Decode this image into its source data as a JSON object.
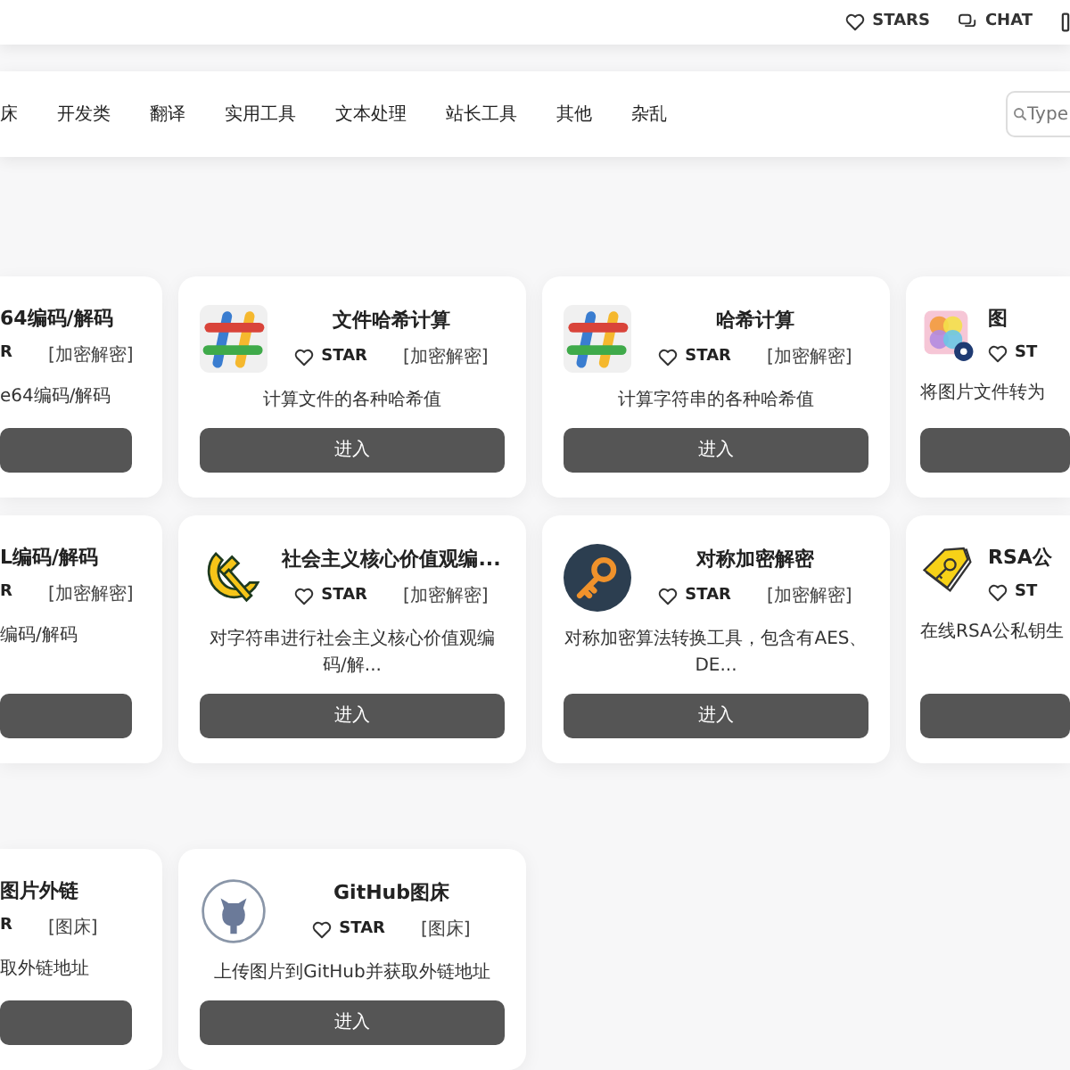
{
  "top_bar": {
    "links": [
      {
        "kind": "heart",
        "label": "STARS"
      },
      {
        "kind": "chat",
        "label": "CHAT"
      },
      {
        "kind": "square"
      }
    ]
  },
  "nav": {
    "items": [
      "床",
      "开发类",
      "翻译",
      "实用工具",
      "文本处理",
      "站长工具",
      "其他",
      "杂乱"
    ],
    "search": {
      "placeholder": "Type"
    }
  },
  "sections": [
    {
      "rows": [
        {
          "cards": [
            {
              "kind": "left-partial",
              "title": "64编码/解码",
              "star": "R",
              "tag": "[加密解密]",
              "desc": "e64编码/解码"
            },
            {
              "kind": "full",
              "icon": {
                "kind": "hash"
              },
              "title": "文件哈希计算",
              "star": "STAR",
              "tag": "[加密解密]",
              "desc": "计算文件的各种哈希值",
              "button": "进入"
            },
            {
              "kind": "full",
              "icon": {
                "kind": "hash"
              },
              "title": "哈希计算",
              "star": "STAR",
              "tag": "[加密解密]",
              "desc": "计算字符串的各种哈希值",
              "button": "进入"
            },
            {
              "kind": "right-partial",
              "icon": {
                "kind": "photos"
              },
              "title": "图",
              "star": "ST",
              "desc": "将图片文件转为"
            }
          ]
        },
        {
          "cards": [
            {
              "kind": "left-partial",
              "title": "L编码/解码",
              "star": "R",
              "tag": "[加密解密]",
              "desc": "编码/解码"
            },
            {
              "kind": "full",
              "icon": {
                "kind": "hammer-sickle"
              },
              "title": "社会主义核心价值观编...",
              "star": "STAR",
              "tag": "[加密解密]",
              "desc": "对字符串进行社会主义核心价值观编码/解...",
              "button": "进入"
            },
            {
              "kind": "full",
              "icon": {
                "kind": "key"
              },
              "title": "对称加密解密",
              "star": "STAR",
              "tag": "[加密解密]",
              "desc": "对称加密算法转换工具，包含有AES、DE...",
              "button": "进入"
            },
            {
              "kind": "right-partial",
              "icon": {
                "kind": "tag-key"
              },
              "title": "RSA公",
              "star": "ST",
              "desc": "在线RSA公私钥生"
            }
          ]
        }
      ]
    },
    {
      "rows": [
        {
          "cards": [
            {
              "kind": "left-partial",
              "title": "图片外链",
              "star": "R",
              "tag": "[图床]",
              "desc": "取外链地址"
            },
            {
              "kind": "full",
              "icon": {
                "kind": "github"
              },
              "title": "GitHub图床",
              "star": "STAR",
              "tag": "[图床]",
              "desc": "上传图片到GitHub并获取外链地址",
              "button": "进入"
            }
          ]
        }
      ]
    }
  ]
}
